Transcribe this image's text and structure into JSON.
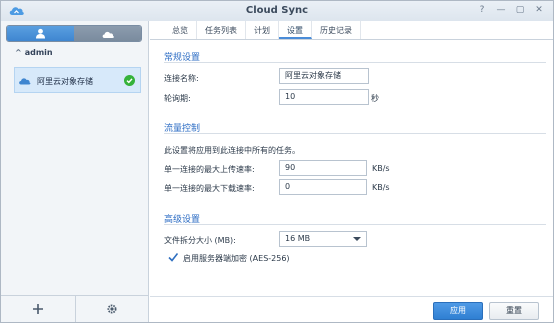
{
  "window": {
    "title": "Cloud Sync"
  },
  "sidebar": {
    "account_label": "admin",
    "task_name": "阿里云对象存储",
    "status_color": "#35b23a"
  },
  "tabs": [
    {
      "label": "总览"
    },
    {
      "label": "任务列表"
    },
    {
      "label": "计划"
    },
    {
      "label": "设置"
    },
    {
      "label": "历史记录"
    }
  ],
  "general": {
    "section_title": "常规设置",
    "connection_name_label": "连接名称:",
    "connection_name_value": "阿里云对象存储",
    "polling_label": "轮询期:",
    "polling_value": "10",
    "polling_unit": "秒"
  },
  "traffic": {
    "section_title": "流量控制",
    "description": "此设置将应用到此连接中所有的任务。",
    "upload_label": "单一连接的最大上传速率:",
    "upload_value": "90",
    "upload_unit": "KB/s",
    "download_label": "单一连接的最大下载速率:",
    "download_value": "0",
    "download_unit": "KB/s"
  },
  "advanced": {
    "section_title": "高级设置",
    "part_size_label": "文件拆分大小 (MB):",
    "part_size_value": "16 MB",
    "encryption_label": "启用服务器端加密 (AES-256)"
  },
  "footer": {
    "apply_label": "应用",
    "reset_label": "重置"
  },
  "colors": {
    "accent": "#2d6dc4",
    "primary_button": "#2f7fd2"
  }
}
